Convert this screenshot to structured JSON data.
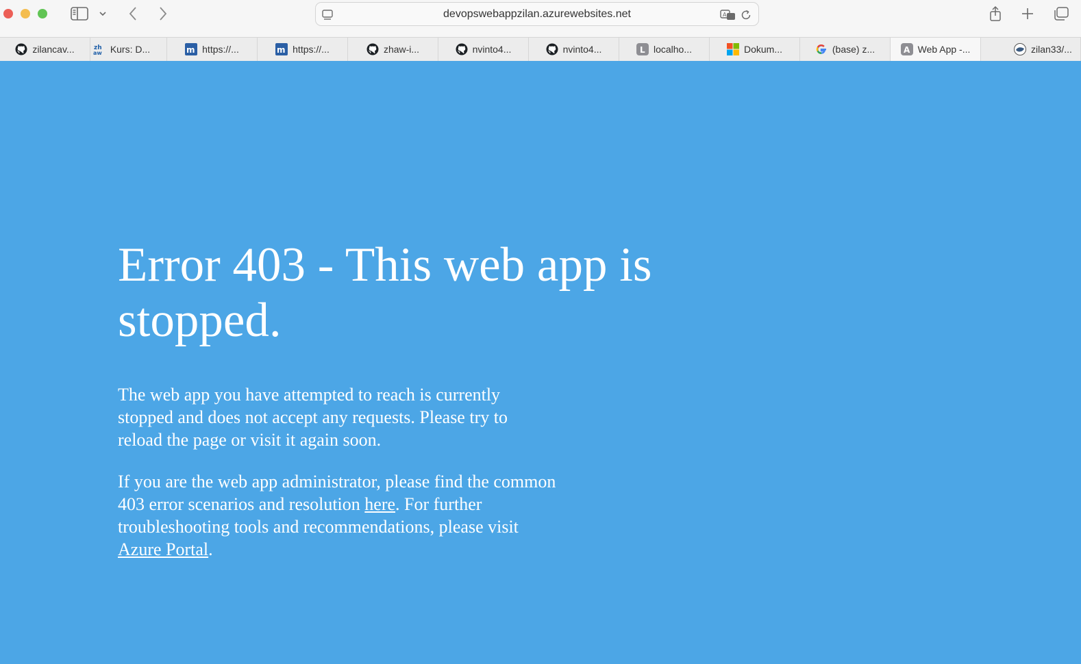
{
  "browser": {
    "url": "devopswebappzilan.azurewebsites.net",
    "tabs": [
      {
        "label": "zilancav...",
        "icon": "github-icon"
      },
      {
        "label": "Kurs: D...",
        "icon": "zhaw-icon"
      },
      {
        "label": "https://...",
        "icon": "moodle-icon"
      },
      {
        "label": "https://...",
        "icon": "moodle-icon"
      },
      {
        "label": "zhaw-i...",
        "icon": "github-icon"
      },
      {
        "label": "nvinto4...",
        "icon": "github-icon"
      },
      {
        "label": "nvinto4...",
        "icon": "github-icon"
      },
      {
        "label": "localho...",
        "icon": "letter-l-icon"
      },
      {
        "label": "Dokum...",
        "icon": "microsoft-icon"
      },
      {
        "label": "(base) z...",
        "icon": "google-icon"
      },
      {
        "label": "Web App -...",
        "icon": "letter-a-icon"
      },
      {
        "label": "zilan33/...",
        "icon": "docker-icon"
      }
    ]
  },
  "page": {
    "title": "Error 403 - This web app is stopped.",
    "para1": "The web app you have attempted to reach is currently stopped and does not accept any requests. Please try to reload the page or visit it again soon.",
    "para2_a": "If you are the web app administrator, please find the common 403 error scenarios and resolution ",
    "link_here": "here",
    "para2_b": ". For further troubleshooting tools and recommendations, please visit ",
    "link_portal": "Azure Portal",
    "para2_c": "."
  },
  "colors": {
    "background": "#4ca6e6",
    "text": "#ffffff"
  }
}
